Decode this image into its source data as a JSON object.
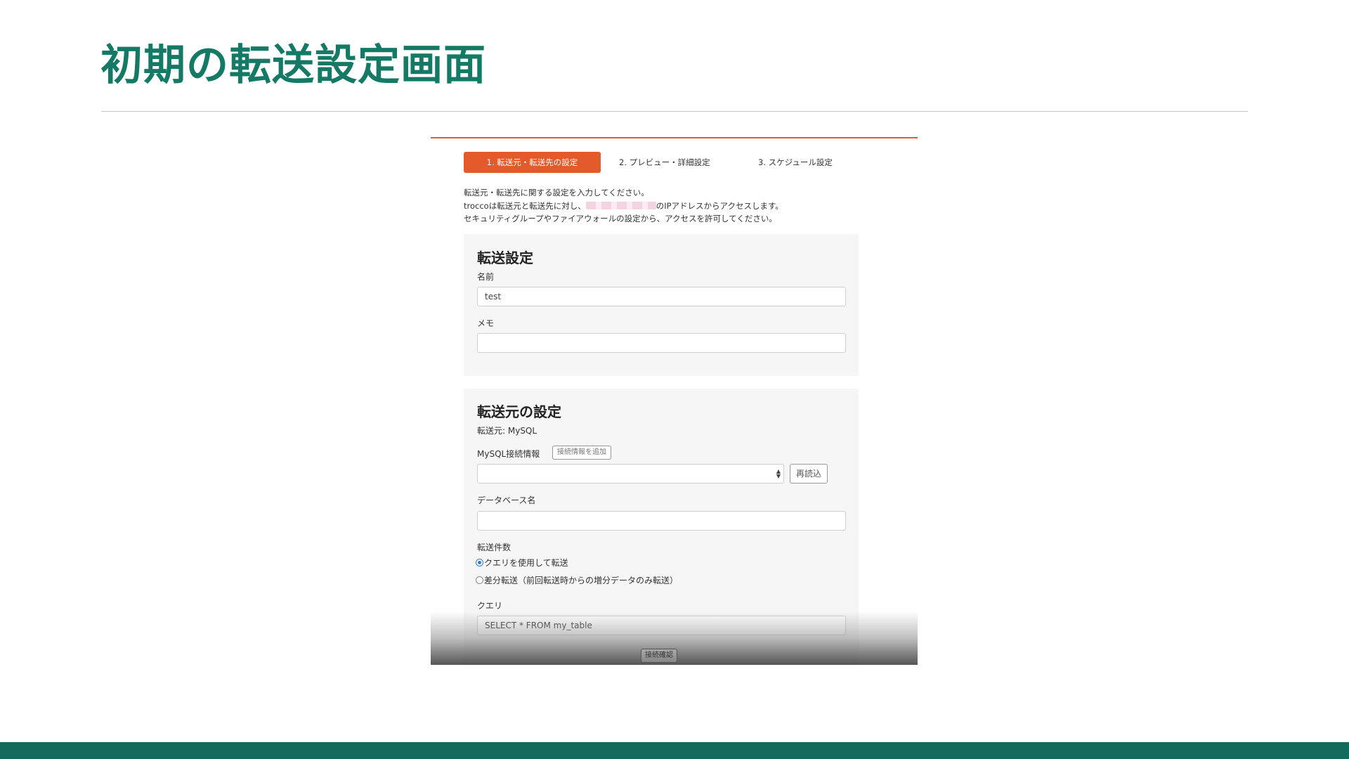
{
  "slide": {
    "title": "初期の転送設定画面"
  },
  "steps": [
    {
      "label": "1. 転送元・転送先の設定",
      "active": true
    },
    {
      "label": "2. プレビュー・詳細設定",
      "active": false
    },
    {
      "label": "3. スケジュール設定",
      "active": false
    }
  ],
  "intro": {
    "line1": "転送元・転送先に関する設定を入力してください。",
    "line2_prefix": "troccoは転送元と転送先に対し、",
    "line2_suffix": "のIPアドレスからアクセスします。",
    "line3": "セキュリティグループやファイアウォールの設定から、アクセスを許可してください。"
  },
  "transfer_settings": {
    "title": "転送設定",
    "name_label": "名前",
    "name_value": "test",
    "memo_label": "メモ",
    "memo_value": ""
  },
  "source_settings": {
    "title": "転送元の設定",
    "source_text": "転送元: MySQL",
    "connection_label": "MySQL接続情報",
    "add_connection_button": "接続情報を追加",
    "connection_selected": "",
    "reload_button": "再読込",
    "database_label": "データベース名",
    "database_value": "",
    "transfer_count_label": "転送件数",
    "radio_options": [
      {
        "label": "クエリを使用して転送",
        "checked": true
      },
      {
        "label": "差分転送（前回転送時からの増分データのみ転送）",
        "checked": false
      }
    ],
    "query_label": "クエリ",
    "query_value": "SELECT * FROM my_table",
    "connection_check_button": "接続確認"
  },
  "colors": {
    "title_green": "#147a66",
    "bottom_bar": "#126b5b",
    "accent_orange": "#e35a2b",
    "radio_blue": "#2c7be5"
  }
}
